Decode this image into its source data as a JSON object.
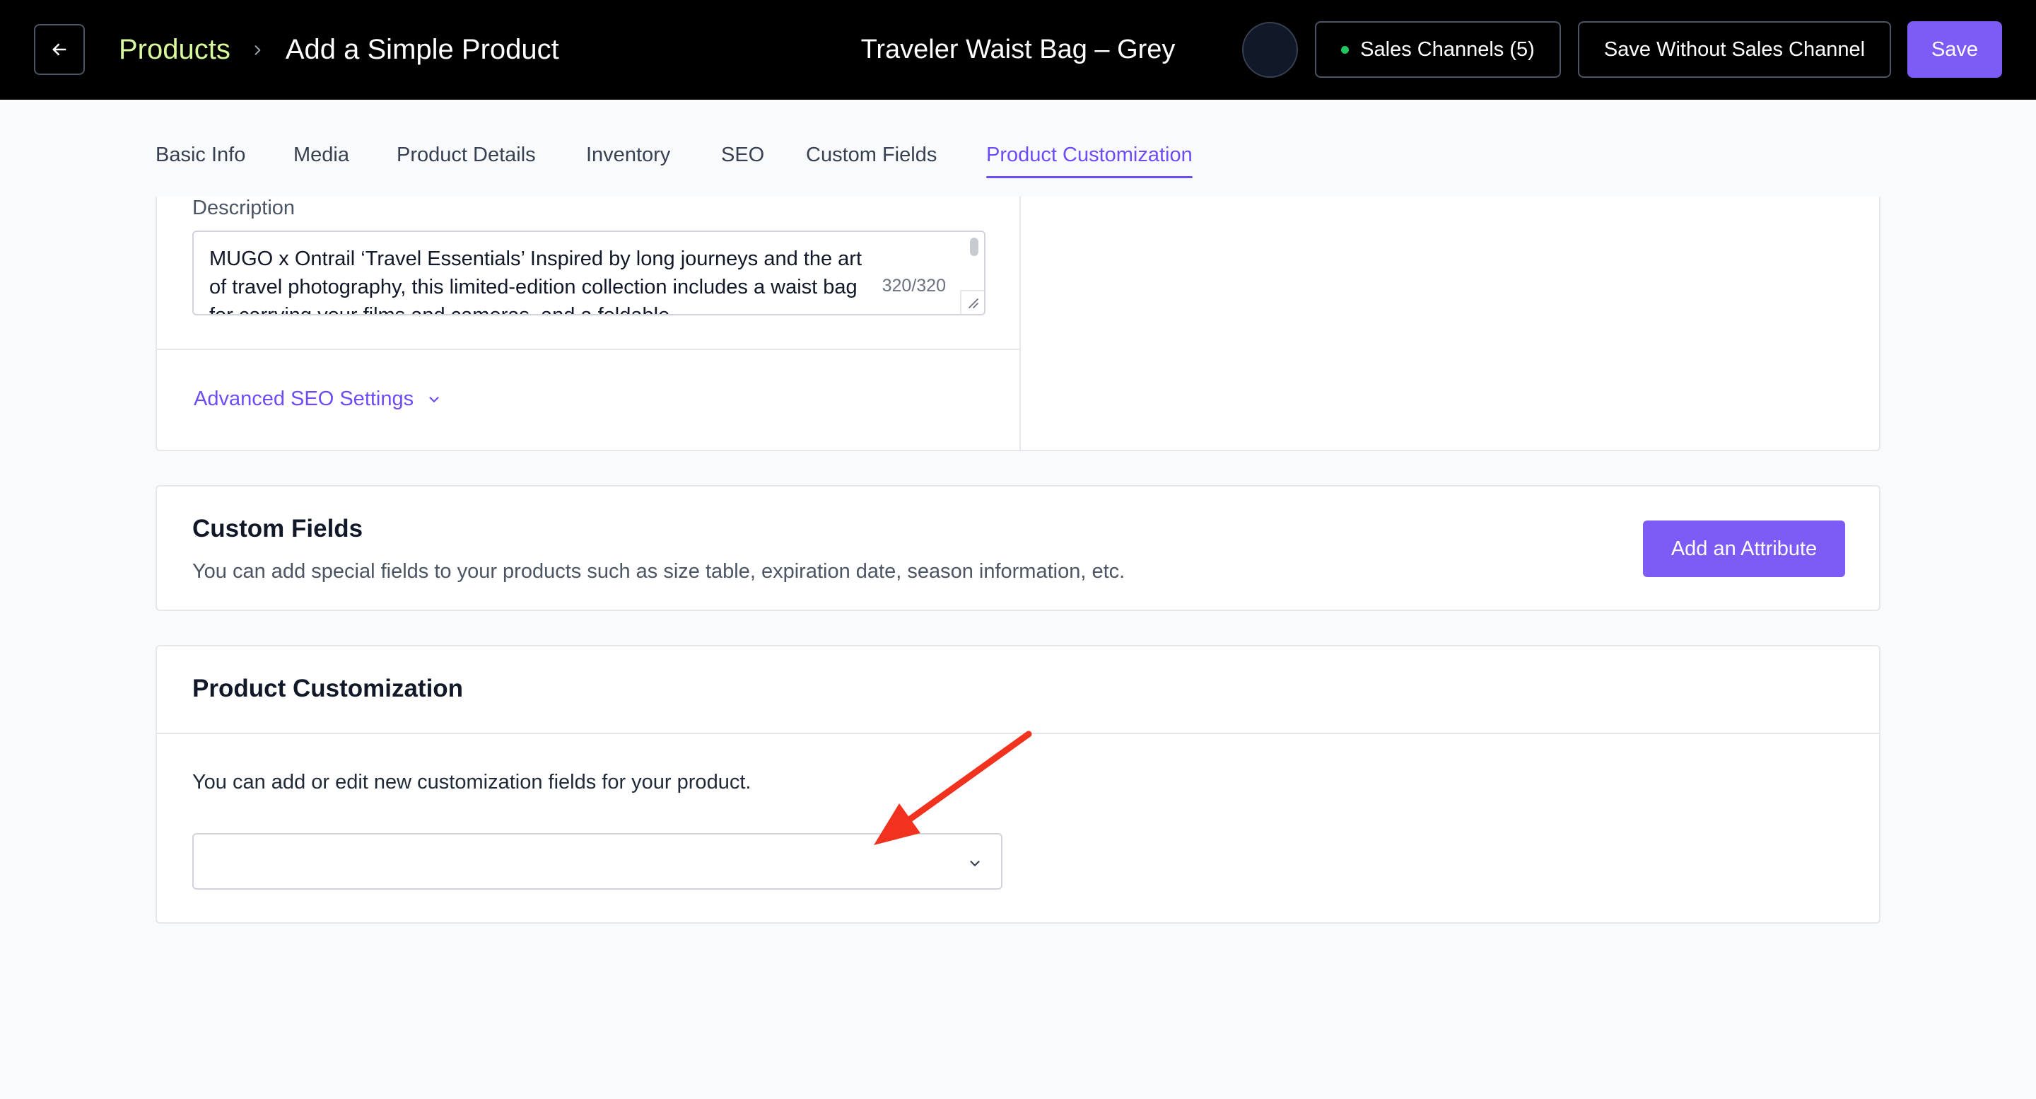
{
  "header": {
    "breadcrumb_link": "Products",
    "breadcrumb_current": "Add a Simple Product",
    "product_name": "Traveler Waist Bag – Grey",
    "sales_channels_label": "Sales Channels (5)",
    "save_without_label": "Save Without Sales Channel",
    "save_label": "Save"
  },
  "tabs": [
    {
      "label": "Basic Info"
    },
    {
      "label": "Media"
    },
    {
      "label": "Product Details"
    },
    {
      "label": "Inventory"
    },
    {
      "label": "SEO"
    },
    {
      "label": "Custom Fields"
    },
    {
      "label": "Product Customization",
      "active": true
    }
  ],
  "seo": {
    "description_label": "Description",
    "description_text": "MUGO x Ontrail ‘Travel Essentials’ Inspired by long journeys and the art of travel photography, this limited-edition collection includes a waist bag for carrying your films and cameras, and a foldable",
    "counter": "320/320",
    "advanced_label": "Advanced SEO Settings"
  },
  "custom_fields": {
    "title": "Custom Fields",
    "description": "You can add special fields to your products such as size table, expiration date, season information, etc.",
    "button_label": "Add an Attribute"
  },
  "product_customization": {
    "title": "Product Customization",
    "description": "You can add or edit new customization fields for your product.",
    "select_value": ""
  },
  "colors": {
    "accent": "#7c5cf5",
    "breadcrumb_link": "#d9f99d",
    "status_dot": "#22c55e",
    "annotation_arrow": "#f0321e"
  },
  "icons": [
    "arrow-left-icon",
    "chevron-right-icon",
    "chevron-down-icon",
    "status-dot-icon",
    "resize-handle-icon"
  ]
}
